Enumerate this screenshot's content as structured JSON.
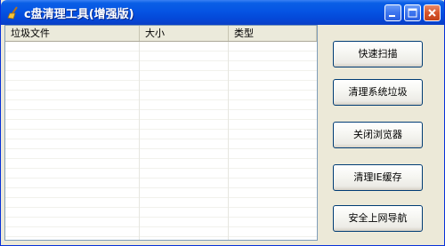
{
  "window": {
    "title": "c盘清理工具(增强版)",
    "icons": {
      "app": "broom-icon",
      "minimize": "minimize-icon",
      "maximize": "maximize-icon",
      "close": "close-icon"
    }
  },
  "list": {
    "columns": [
      "垃圾文件",
      "大小",
      "类型"
    ],
    "rows": []
  },
  "buttons": {
    "quick_scan": "快速扫描",
    "clean_system_junk": "清理系统垃圾",
    "close_browser": "关闭浏览器",
    "clean_ie_cache": "清理IE缓存",
    "safe_nav": "安全上网导航"
  },
  "colors": {
    "titlebar": "#0554e3",
    "window_bg": "#ece9d8",
    "close_button": "#d7552b"
  }
}
